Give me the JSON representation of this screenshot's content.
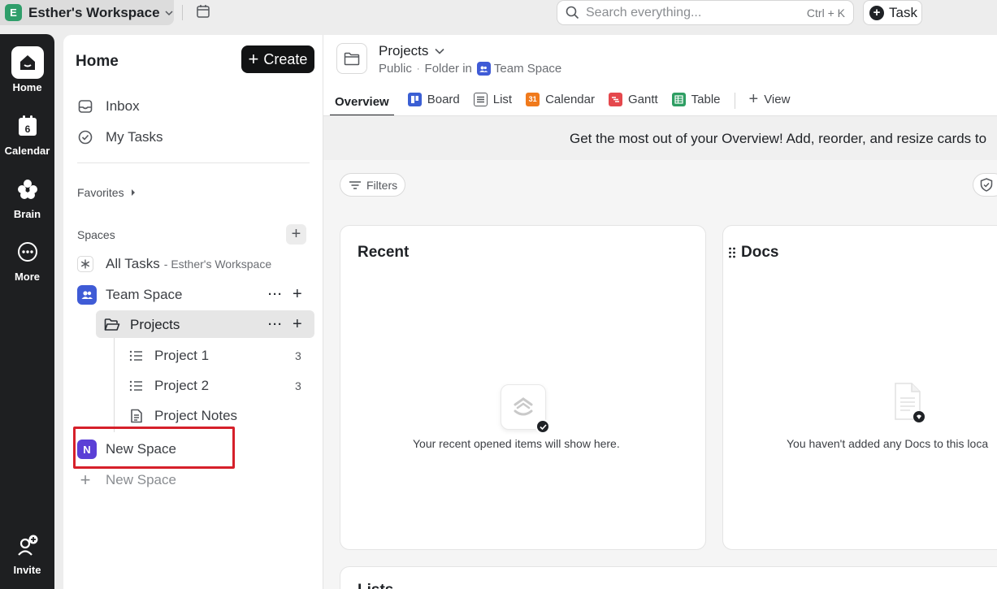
{
  "workspace": {
    "initial": "E",
    "name": "Esther's Workspace"
  },
  "search": {
    "placeholder": "Search everything...",
    "shortcut": "Ctrl + K"
  },
  "task_button": {
    "label": "Task"
  },
  "rail": {
    "items": [
      {
        "label": "Home",
        "icon": "home-icon"
      },
      {
        "label": "Calendar",
        "icon": "calendar-icon",
        "badge": "6"
      },
      {
        "label": "Brain",
        "icon": "brain-icon"
      },
      {
        "label": "More",
        "icon": "more-icon"
      },
      {
        "label": "Invite",
        "icon": "invite-icon"
      }
    ]
  },
  "sidebar": {
    "title": "Home",
    "create_label": "Create",
    "inbox": "Inbox",
    "my_tasks": "My Tasks",
    "favorites": "Favorites",
    "spaces": "Spaces",
    "all_tasks": "All Tasks",
    "all_tasks_sub": "- Esther's Workspace",
    "team_space": "Team Space",
    "projects": "Projects",
    "project1": "Project 1",
    "project1_count": "3",
    "project2": "Project 2",
    "project2_count": "3",
    "project_notes": "Project Notes",
    "new_space_initial": "N",
    "new_space": "New Space",
    "add_new_space": "New Space"
  },
  "header": {
    "title": "Projects",
    "visibility": "Public",
    "folder_in": "Folder in",
    "parent_space": "Team Space"
  },
  "tabs": {
    "overview": "Overview",
    "board": "Board",
    "list": "List",
    "calendar": "Calendar",
    "calendar_badge": "31",
    "gantt": "Gantt",
    "table": "Table",
    "view": "View"
  },
  "banner": {
    "text": "Get the most out of your Overview! Add, reorder, and resize cards to"
  },
  "filters_label": "Filters",
  "cards": {
    "recent_title": "Recent",
    "recent_empty": "Your recent opened items will show here.",
    "docs_title": "Docs",
    "docs_empty": "You haven't added any Docs to this loca",
    "lists_title": "Lists"
  },
  "colors": {
    "workspace_avatar": "#2f9e6a",
    "team_space": "#3f5bd6",
    "new_space": "#5b3fd6",
    "board": "#3b5fd4",
    "calendar": "#f07a1c",
    "gantt": "#e5484d",
    "table": "#2e9e63",
    "highlight": "#d6202a"
  }
}
